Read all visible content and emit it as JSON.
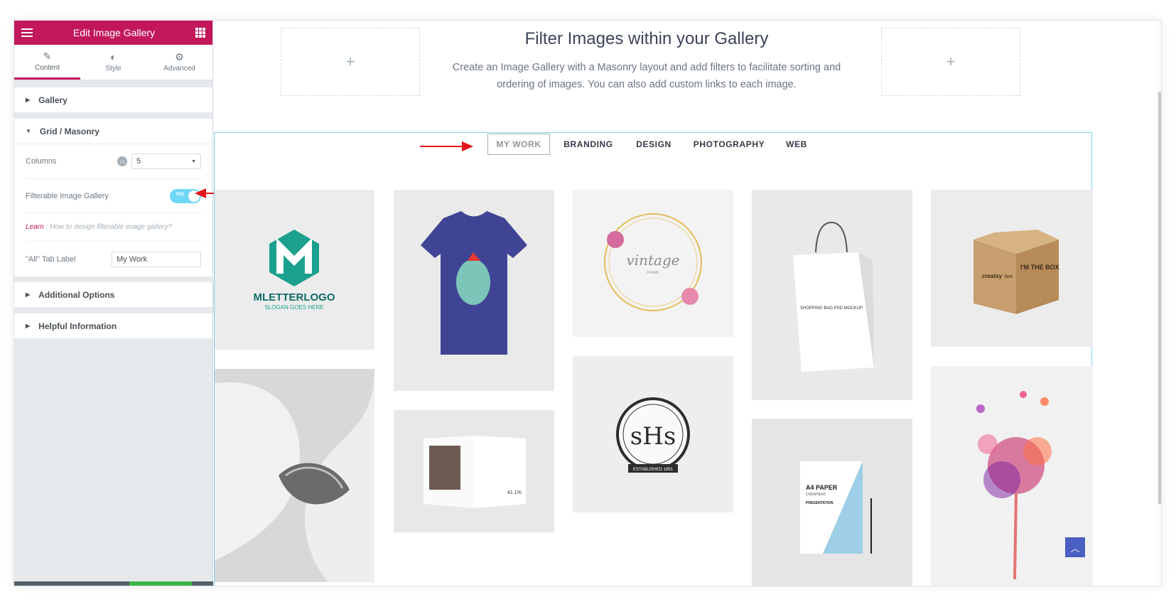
{
  "panel": {
    "title": "Edit Image Gallery",
    "tabs": [
      {
        "label": "Content",
        "icon": "pencil-icon"
      },
      {
        "label": "Style",
        "icon": "contrast-icon"
      },
      {
        "label": "Advanced",
        "icon": "gear-icon"
      }
    ],
    "sections": {
      "gallery": "Gallery",
      "grid": "Grid / Masonry",
      "additional": "Additional Options",
      "helpful": "Helpful Information"
    },
    "columns": {
      "label": "Columns",
      "value": "5"
    },
    "filterable": {
      "label": "Filterable Image Gallery",
      "toggle_text": "YES",
      "on": true
    },
    "learn": {
      "link": "Learn",
      "text": ": How to design filterable image gallery?"
    },
    "all_tab": {
      "label": "\"All\" Tab Label",
      "value": "My Work"
    }
  },
  "canvas": {
    "heading": "Filter Images within your Gallery",
    "description_line1": "Create an Image Gallery with a Masonry layout and add filters to facilitate sorting and",
    "description_line2": "ordering of images. You can also add custom links to each image.",
    "add_glyph": "+",
    "filters": [
      "MY WORK",
      "BRANDING",
      "DESIGN",
      "PHOTOGRAPHY",
      "WEB"
    ],
    "active_filter": "MY WORK",
    "images": {
      "logo_title": "MLETTERLOGO",
      "logo_slogan": "SLOGAN GOES HERE",
      "vintage": "vintage",
      "vintage_sub": "FRAME",
      "box_brand": "creatsy",
      "box_brand_2": "box",
      "box_text": "I'M THE BOX",
      "bag_text": "SHOPPING BAG PSD MOCKUP",
      "monogram": "sHs",
      "monogram_banner": "ESTABLISHED 1991",
      "book_percent": "41.1%",
      "a4_title": "A4 PAPER",
      "a4_sub": "OVERHEAD",
      "a4_pres": "PRESENTATION"
    }
  },
  "colors": {
    "brand": "#c2185b",
    "toggle": "#71d7f7",
    "gallery_border": "#7fd3ec",
    "arrow": "#e8141d",
    "scroll_top": "#4a5fc1"
  }
}
